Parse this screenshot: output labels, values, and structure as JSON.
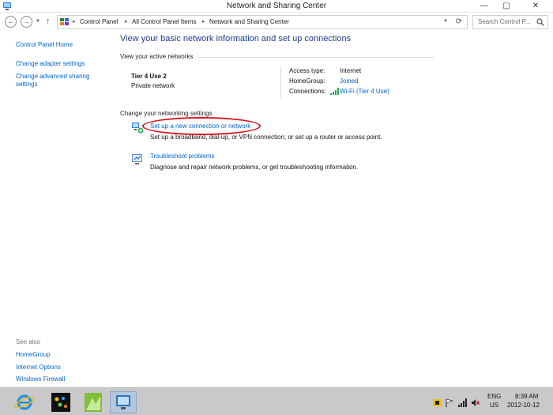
{
  "window": {
    "title": "Network and Sharing Center"
  },
  "address_bar": {
    "crumbs": [
      "Control Panel",
      "All Control Panel Items",
      "Network and Sharing Center"
    ],
    "search_placeholder": "Search Control P..."
  },
  "left_pane": {
    "items": [
      "Control Panel Home",
      "Change adapter settings",
      "Change advanced sharing settings"
    ],
    "see_also_label": "See also",
    "see_also": [
      "HomeGroup",
      "Internet Options",
      "Windows Firewall"
    ]
  },
  "main": {
    "heading": "View your basic network information and set up connections",
    "active_networks_label": "View your active networks",
    "network": {
      "name": "Tier 4 Use  2",
      "type": "Private network",
      "access_type_label": "Access type:",
      "access_type_value": "Internet",
      "homegroup_label": "HomeGroup:",
      "homegroup_value": "Joined",
      "connections_label": "Connections:",
      "connections_value": "Wi-Fi (Tier 4 Use)"
    },
    "change_settings_label": "Change your networking settings",
    "tasks": [
      {
        "link": "Set up a new connection or network",
        "desc": "Set up a broadband, dial-up, or VPN connection; or set up a router or access point."
      },
      {
        "link": "Troubleshoot problems",
        "desc": "Diagnose and repair network problems, or get troubleshooting information."
      }
    ]
  },
  "taskbar": {
    "lang": "ENG",
    "region": "US",
    "time": "8:39 AM",
    "date": "2012-10-12"
  },
  "colors": {
    "link": "#0066cc",
    "heading": "#1e3c8c",
    "annotation": "#d8121e"
  }
}
